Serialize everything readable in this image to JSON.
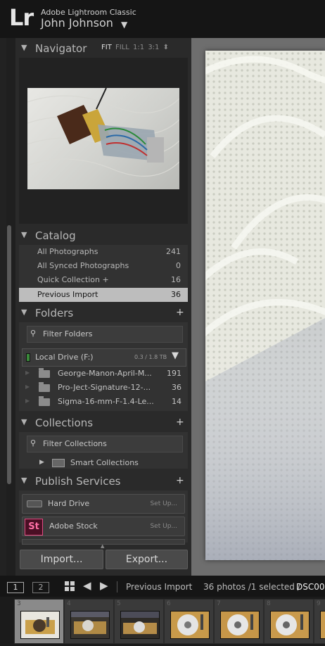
{
  "app": {
    "logo": "Lr",
    "name": "Adobe Lightroom Classic",
    "user": "John Johnson",
    "user_menu_glyph": "▼"
  },
  "navigator": {
    "title": "Navigator",
    "zoom": [
      "FIT",
      "FILL",
      "1:1",
      "3:1"
    ],
    "active_zoom": "FIT",
    "zoom_menu_glyph": "⬍"
  },
  "catalog": {
    "title": "Catalog",
    "items": [
      {
        "label": "All Photographs",
        "count": "241"
      },
      {
        "label": "All Synced Photographs",
        "count": "0"
      },
      {
        "label": "Quick Collection  +",
        "count": "16"
      },
      {
        "label": "Previous Import",
        "count": "36",
        "selected": true
      }
    ]
  },
  "folders": {
    "title": "Folders",
    "filter_placeholder": "Filter Folders",
    "drive": {
      "name": "Local Drive (F:)",
      "size": "0.3 / 1.8 TB",
      "status_color": "#3a8a3a"
    },
    "items": [
      {
        "name": "George-Manon-April-M...",
        "count": "191"
      },
      {
        "name": "Pro-Ject-Signature-12-...",
        "count": "36"
      },
      {
        "name": "Sigma-16-mm-F-1.4-Le...",
        "count": "14"
      }
    ]
  },
  "collections": {
    "title": "Collections",
    "filter_placeholder": "Filter Collections",
    "smart": "Smart Collections"
  },
  "publish": {
    "title": "Publish Services",
    "services": [
      {
        "name": "Hard Drive",
        "action": "Set Up..."
      },
      {
        "name": "Adobe Stock",
        "action": "Set Up...",
        "icon_text": "St"
      }
    ]
  },
  "buttons": {
    "import": "Import...",
    "export": "Export..."
  },
  "toolbar": {
    "view1": "1",
    "view2": "2",
    "source": "Previous Import",
    "count": "36 photos /1 selected /",
    "filename": "DSC00"
  },
  "filmstrip": {
    "numbers": [
      "3",
      "4",
      "5",
      "6",
      "7",
      "8",
      "9"
    ]
  },
  "colors": {
    "accent": "#bdbdbd",
    "stock_pink": "#e24a82"
  }
}
